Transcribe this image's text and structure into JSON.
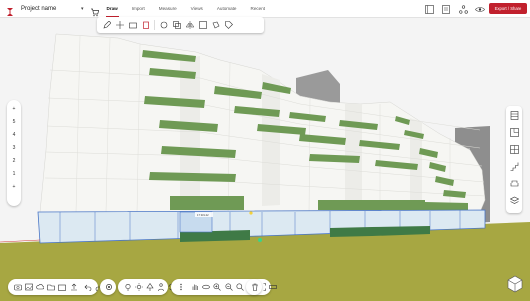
{
  "app": {
    "project_name": "Project name",
    "export_label": "Export / Share"
  },
  "nav": {
    "tabs": [
      "Draw",
      "Import",
      "Measure",
      "Views",
      "Automate",
      "Recent"
    ],
    "active": "Draw"
  },
  "floor_selector": {
    "up": "+",
    "levels": [
      "5",
      "4",
      "3",
      "2",
      "1"
    ],
    "down": "+"
  },
  "viewport": {
    "dimension_labels": [
      "17 331.22"
    ]
  },
  "colors": {
    "accent": "#c1202d",
    "balcony_green": "#6f9a55",
    "ground": "#a5a53f",
    "glass_floor": "#d8e6ef",
    "facade": "#f6f6f3",
    "dark_green": "#3f7a46"
  },
  "icons": {
    "draw_toolbar": [
      "pencil-icon",
      "move-icon",
      "cut-icon",
      "delete-icon",
      "rotate-icon",
      "copy-icon",
      "mirror-icon",
      "group-icon",
      "paint-icon",
      "tag-icon"
    ],
    "top_right": [
      "grid-icon",
      "document-icon",
      "network-icon",
      "eye-icon"
    ],
    "right_tools": [
      "building-icon",
      "floorplan-icon",
      "window-icon",
      "stairs-icon",
      "sofa-icon",
      "layers-icon"
    ],
    "bottom_left": [
      "camera-icon",
      "image-icon",
      "cloud-icon",
      "folder-icon",
      "share-icon",
      "export-icon",
      "undo-icon",
      "redo-icon",
      "settings-icon"
    ],
    "bottom_middle": [
      "light-icon",
      "sun-icon",
      "tree-icon",
      "person-icon",
      "sync-icon"
    ],
    "bottom_right": [
      "more-icon",
      "hand-icon",
      "orbit-icon",
      "zoom-in-icon",
      "zoom-out-icon",
      "zoom-extent-icon",
      "walk-icon",
      "fullscreen-icon",
      "measure-icon",
      "trash-icon"
    ]
  }
}
